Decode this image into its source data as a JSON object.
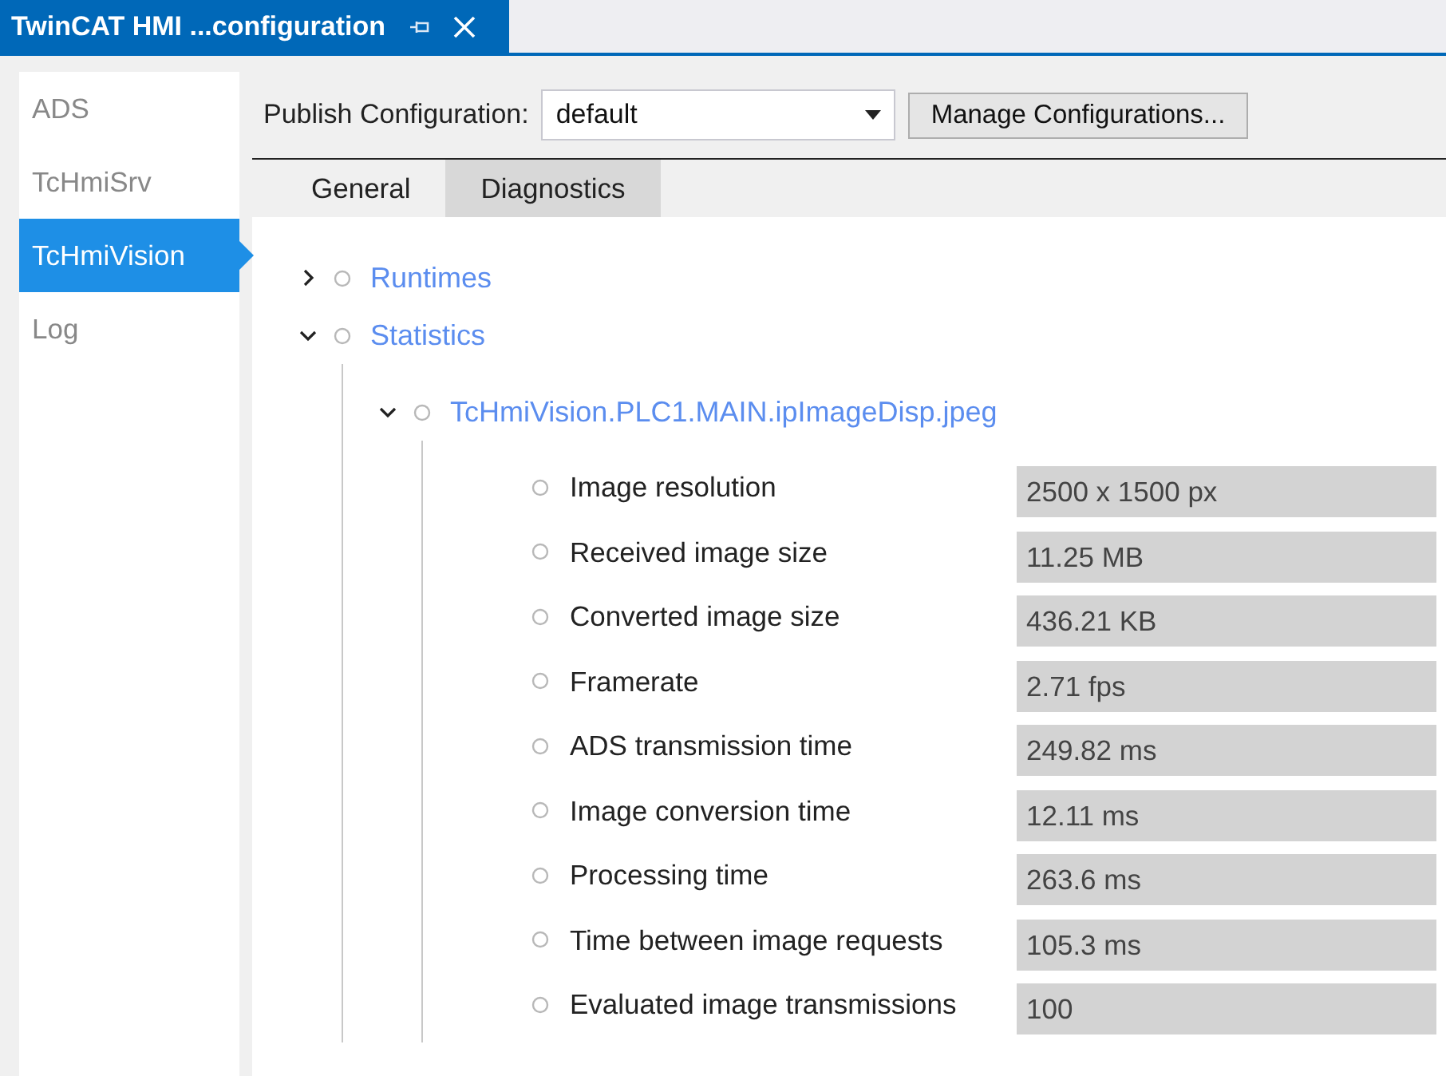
{
  "window": {
    "title": "TwinCAT HMI ...configuration"
  },
  "sidebar": {
    "items": [
      {
        "label": "ADS",
        "selected": false
      },
      {
        "label": "TcHmiSrv",
        "selected": false
      },
      {
        "label": "TcHmiVision",
        "selected": true
      },
      {
        "label": "Log",
        "selected": false
      }
    ]
  },
  "publish": {
    "label": "Publish Configuration:",
    "value": "default",
    "button": "Manage Configurations..."
  },
  "tabs": [
    {
      "label": "General",
      "selected": false
    },
    {
      "label": "Diagnostics",
      "selected": true
    }
  ],
  "tree": [
    {
      "kind": "node",
      "label": "Runtimes",
      "expanded": false
    },
    {
      "kind": "node",
      "label": "Statistics",
      "expanded": true,
      "children": [
        {
          "kind": "node",
          "label": "TcHmiVision.PLC1.MAIN.ipImageDisp.jpeg",
          "expanded": true,
          "children": [
            {
              "kind": "field",
              "label": "Image resolution",
              "value": "2500 x 1500 px"
            },
            {
              "kind": "field",
              "label": "Received image size",
              "value": "11.25 MB"
            },
            {
              "kind": "field",
              "label": "Converted image size",
              "value": "436.21 KB"
            },
            {
              "kind": "field",
              "label": "Framerate",
              "value": "2.71 fps"
            },
            {
              "kind": "field",
              "label": "ADS transmission time",
              "value": "249.82 ms"
            },
            {
              "kind": "field",
              "label": "Image conversion time",
              "value": "12.11 ms"
            },
            {
              "kind": "field",
              "label": "Processing time",
              "value": "263.6 ms"
            },
            {
              "kind": "field",
              "label": "Time between image requests",
              "value": "105.3 ms"
            },
            {
              "kind": "field",
              "label": "Evaluated image transmissions",
              "value": "100"
            }
          ]
        }
      ]
    }
  ]
}
